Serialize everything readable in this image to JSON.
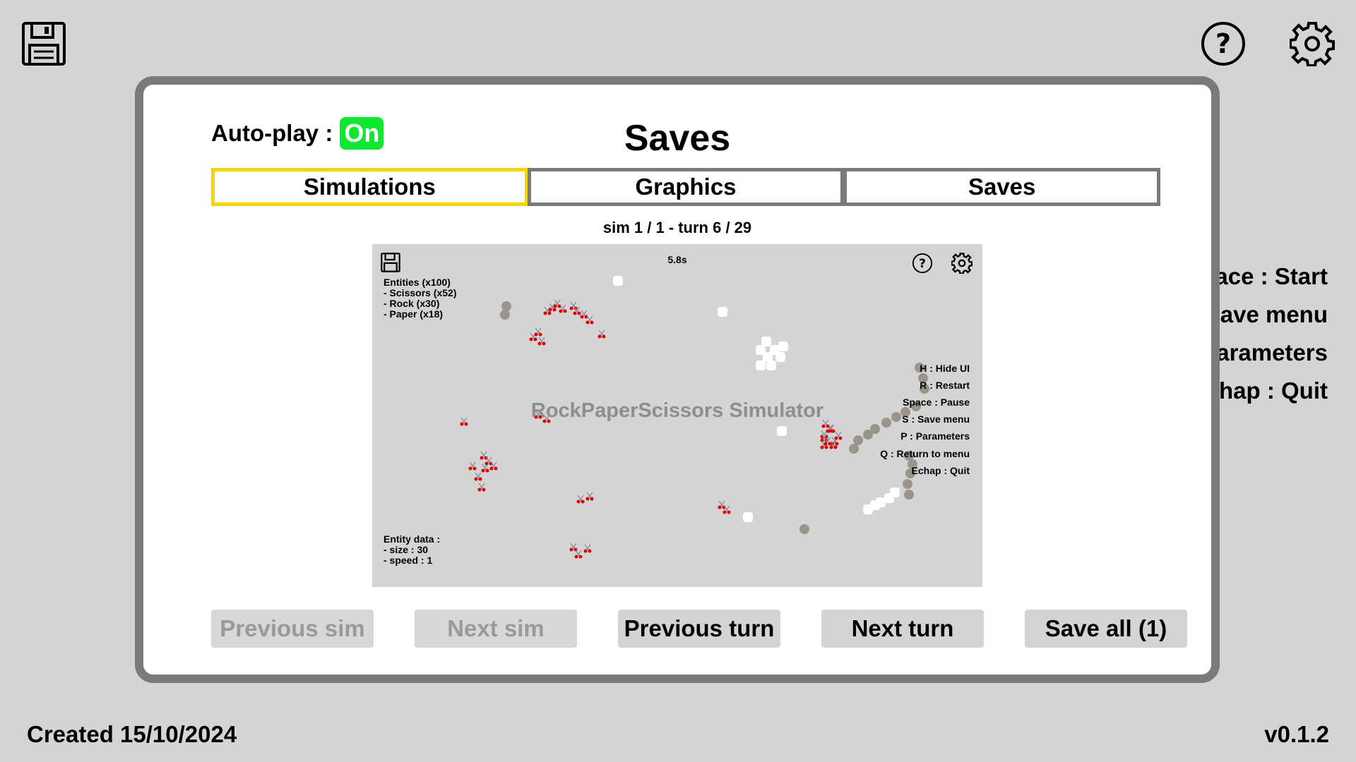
{
  "icons": {
    "save": "save-floppy-icon",
    "help": "help-question-icon",
    "settings": "gear-icon"
  },
  "background_keys": [
    "ace : Start",
    "ave menu",
    "arameters",
    "hap : Quit"
  ],
  "footer": {
    "created": "Created 15/10/2024",
    "version": "v0.1.2"
  },
  "dialog": {
    "title": "Saves",
    "autoplay_label": "Auto-play :",
    "autoplay_value": "On",
    "tabs": [
      "Simulations",
      "Graphics",
      "Saves"
    ],
    "active_tab": "Simulations",
    "sim_status": "sim 1 / 1 - turn 6 / 29",
    "buttons": {
      "previous_sim": "Previous sim",
      "next_sim": "Next sim",
      "previous_turn": "Previous turn",
      "next_turn": "Next turn",
      "save_all": "Save all (1)"
    }
  },
  "preview": {
    "timer": "5.8s",
    "title": "RockPaperScissors Simulator",
    "entities": {
      "header": "Entities (x100)",
      "scissors": "- Scissors (x52)",
      "rock": "- Rock (x30)",
      "paper": "- Paper (x18)"
    },
    "entity_data": {
      "header": "Entity data :",
      "size": "- size : 30",
      "speed": "- speed : 1"
    },
    "keys": [
      "H : Hide UI",
      "R : Restart",
      "Space : Pause",
      "S : Save menu",
      "P : Parameters",
      "Q : Return to menu",
      "Echap : Quit"
    ]
  },
  "colors": {
    "background": "#d4d4d4",
    "panel_border": "#7a7a7a",
    "active_tab_border": "#f5d400",
    "toggle_on": "#0fe82f",
    "scissors": "#e00000",
    "rock": "#9a948a",
    "paper": "#ffffff"
  }
}
